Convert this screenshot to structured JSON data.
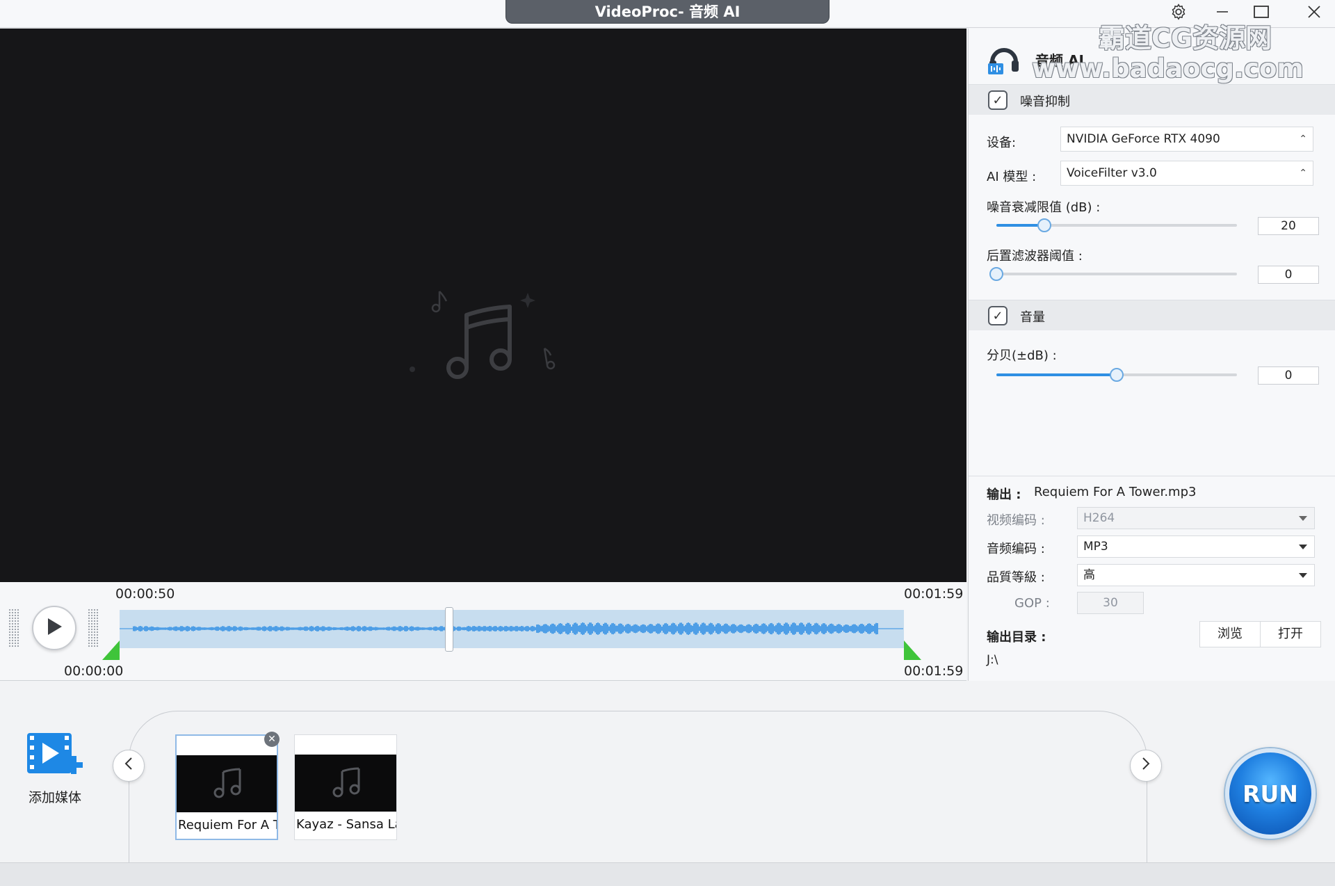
{
  "window": {
    "title": "VideoProc- 音频 AI",
    "icons": {
      "settings": "gear-icon",
      "minimize": "minimize-icon",
      "maximize": "maximize-icon",
      "close": "close-icon"
    }
  },
  "watermark": {
    "line1": "霸道CG资源网",
    "line2": "www.badaocg.com"
  },
  "preview": {
    "icon": "music-note-icon",
    "background": "#161618"
  },
  "timeline": {
    "current_time": "00:00:50",
    "end_time_top": "00:01:59",
    "start_time": "00:00:00",
    "end_time_bottom": "00:01:59",
    "playhead_fraction": 0.42,
    "waveform_color": "#2f8fe3",
    "marker_color": "#3fc43a"
  },
  "panel": {
    "title": "音频 AI",
    "noise_section": {
      "label": "噪音抑制",
      "checked": true,
      "device_label": "设备:",
      "device_value": "NVIDIA GeForce RTX 4090",
      "model_label": "AI 模型 :",
      "model_value": "VoiceFilter v3.0",
      "threshold_label": "噪音衰减限值 (dB) :",
      "threshold_value": "20",
      "threshold_fraction": 0.2,
      "postfilter_label": "后置滤波器阈值 :",
      "postfilter_value": "0",
      "postfilter_fraction": 0.0
    },
    "volume_section": {
      "label": "音量",
      "checked": true,
      "db_label": "分贝(±dB) :",
      "db_value": "0",
      "db_fraction": 0.5
    },
    "output": {
      "label": "输出 :",
      "filename": "Requiem For A Tower.mp3",
      "video_codec_label": "视频编码 :",
      "video_codec_value": "H264",
      "audio_codec_label": "音频编码 :",
      "audio_codec_value": "MP3",
      "quality_label": "品質等級 :",
      "quality_value": "高",
      "gop_label": "GOP :",
      "gop_value": "30",
      "dir_label": "输出目录 :",
      "browse_label": "浏览",
      "open_label": "打开",
      "dir_path": "J:\\"
    },
    "accent_color": "#2f8fe3"
  },
  "bottom": {
    "add_media_label": "添加媒体",
    "add_media_icon": "add-video-icon",
    "prev_icon": "chevron-left-icon",
    "next_icon": "chevron-right-icon",
    "media": [
      {
        "label": "Requiem For A T",
        "selected": true,
        "icon": "music-note-icon"
      },
      {
        "label": "Kayaz - Sansa La",
        "selected": false,
        "icon": "music-note-icon"
      }
    ],
    "run_label": "RUN"
  }
}
